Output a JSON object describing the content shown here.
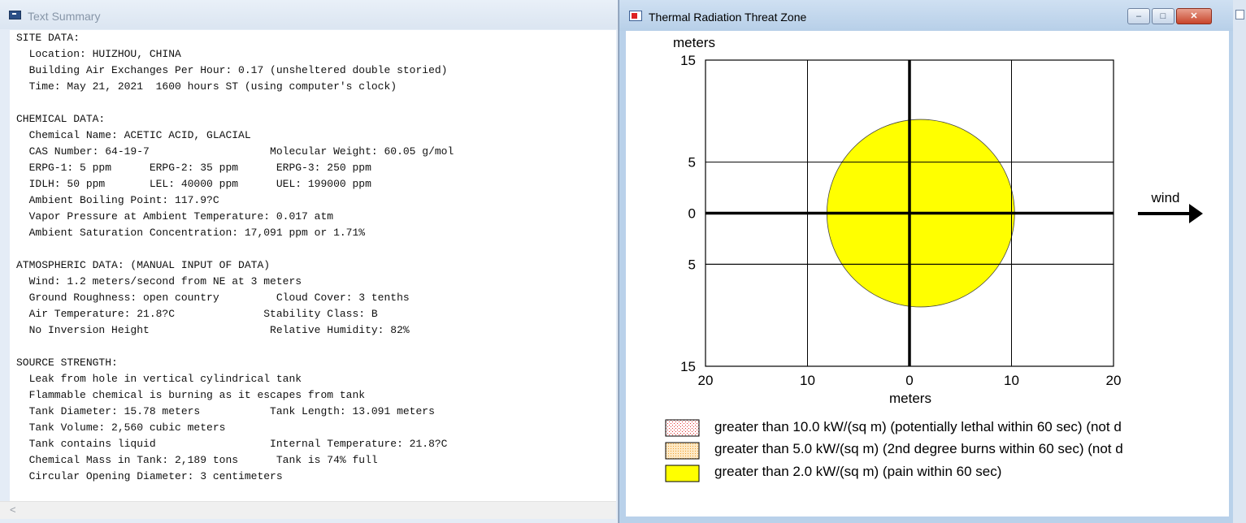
{
  "text_window": {
    "title": "Text Summary",
    "scroll_left_arrow": "<",
    "lines": [
      "SITE DATA:",
      "  Location: HUIZHOU, CHINA",
      "  Building Air Exchanges Per Hour: 0.17 (unsheltered double storied)",
      "  Time: May 21, 2021  1600 hours ST (using computer's clock)",
      "",
      "CHEMICAL DATA:",
      "  Chemical Name: ACETIC ACID, GLACIAL",
      "  CAS Number: 64-19-7                   Molecular Weight: 60.05 g/mol",
      "  ERPG-1: 5 ppm      ERPG-2: 35 ppm      ERPG-3: 250 ppm",
      "  IDLH: 50 ppm       LEL: 40000 ppm      UEL: 199000 ppm",
      "  Ambient Boiling Point: 117.9?C",
      "  Vapor Pressure at Ambient Temperature: 0.017 atm",
      "  Ambient Saturation Concentration: 17,091 ppm or 1.71%",
      "",
      "ATMOSPHERIC DATA: (MANUAL INPUT OF DATA)",
      "  Wind: 1.2 meters/second from NE at 3 meters",
      "  Ground Roughness: open country         Cloud Cover: 3 tenths",
      "  Air Temperature: 21.8?C              Stability Class: B",
      "  No Inversion Height                   Relative Humidity: 82%",
      "",
      "SOURCE STRENGTH:",
      "  Leak from hole in vertical cylindrical tank",
      "  Flammable chemical is burning as it escapes from tank",
      "  Tank Diameter: 15.78 meters           Tank Length: 13.091 meters",
      "  Tank Volume: 2,560 cubic meters",
      "  Tank contains liquid                  Internal Temperature: 21.8?C",
      "  Chemical Mass in Tank: 2,189 tons      Tank is 74% full",
      "  Circular Opening Diameter: 3 centimeters"
    ]
  },
  "threat_window": {
    "title": "Thermal Radiation Threat Zone",
    "buttons": {
      "minimize": "–",
      "maximize": "□",
      "close": "✕"
    },
    "plot": {
      "y_unit": "meters",
      "x_unit": "meters",
      "y_tick_labels": [
        "15",
        "5",
        "0",
        "5",
        "15"
      ],
      "x_tick_labels": [
        "20",
        "10",
        "0",
        "10",
        "20"
      ],
      "x_range": [
        -20,
        20
      ],
      "y_range": [
        -15,
        15
      ],
      "grid_x": [
        -10,
        0,
        10
      ],
      "grid_y": [
        5,
        0,
        -5
      ],
      "zone": {
        "shape": "circle",
        "center_x": 1.1,
        "center_y": 0.0,
        "radius_m": 9.2,
        "color": "#ffff00"
      },
      "wind_label": "wind",
      "wind_direction": "right"
    },
    "legend": [
      {
        "label": "greater than 10.0 kW/(sq m) (potentially lethal within 60 sec) (not d",
        "swatch": "red-dotted",
        "color": "#e03030"
      },
      {
        "label": "greater than 5.0 kW/(sq m) (2nd degree burns within 60 sec) (not d",
        "swatch": "orange-dotted",
        "color": "#f0a030"
      },
      {
        "label": "greater than 2.0 kW/(sq m) (pain within 60 sec)",
        "swatch": "yellow",
        "color": "#ffff00"
      }
    ]
  }
}
